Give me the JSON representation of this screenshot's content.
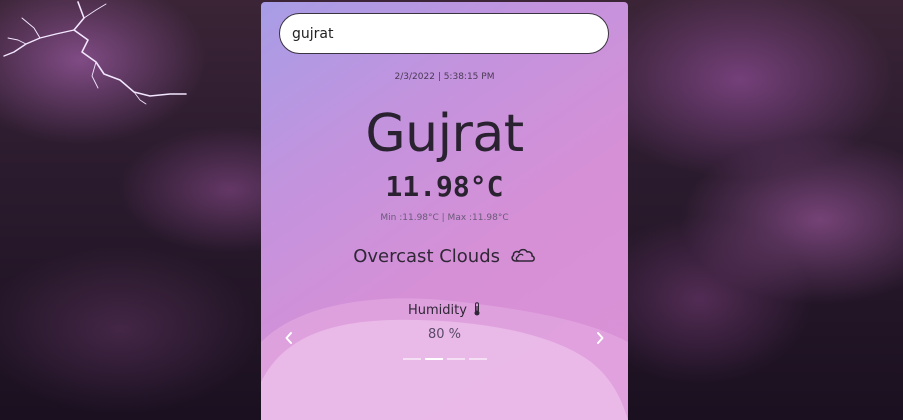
{
  "search": {
    "value": "gujrat"
  },
  "weather": {
    "datetime": "2/3/2022 | 5:38:15 PM",
    "city": "Gujrat",
    "temperature": "11.98°C",
    "minmax": "Min :11.98°C | Max :11.98°C",
    "condition": "Overcast Clouds",
    "condition_icon": "cloud-icon"
  },
  "slider": {
    "label": "Humidity",
    "label_icon": "thermometer-icon",
    "value": "80 %",
    "slide_count": 4,
    "active_slide": 2
  },
  "colors": {
    "card_gradient_start": "#a79de6",
    "card_gradient_end": "#db92d7",
    "text_dark": "#2a2230"
  }
}
